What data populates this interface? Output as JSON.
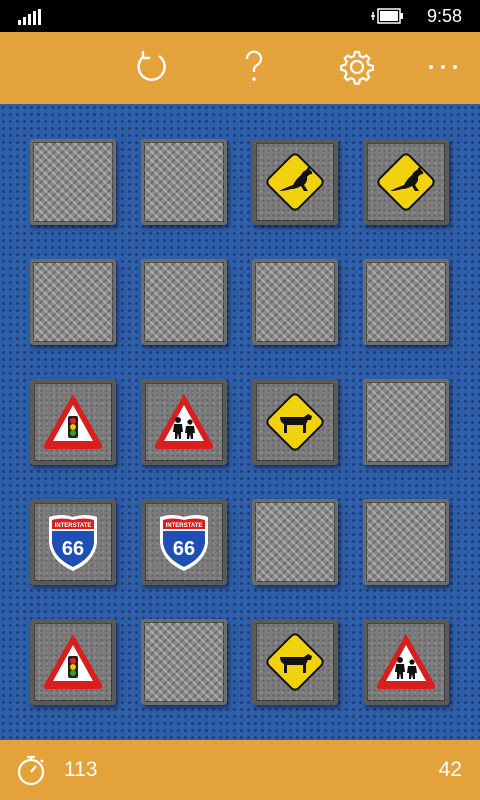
{
  "status": {
    "time": "9:58"
  },
  "toolbar": {
    "buttons": [
      {
        "name": "restart-button",
        "icon": "refresh-icon"
      },
      {
        "name": "help-button",
        "icon": "question-icon"
      },
      {
        "name": "settings-button",
        "icon": "gear-icon"
      },
      {
        "name": "more-button",
        "icon": "ellipsis-icon"
      }
    ]
  },
  "board": {
    "rows": 5,
    "cols": 4,
    "tiles": [
      "hidden",
      "hidden",
      "kangaroo-sign",
      "kangaroo-sign",
      "hidden",
      "hidden",
      "hidden",
      "hidden",
      "traffic-light-sign",
      "school-children-sign",
      "cattle-sign",
      "hidden",
      "route-66-sign",
      "route-66-sign",
      "hidden",
      "hidden",
      "traffic-light-sign",
      "hidden",
      "cattle-sign",
      "school-children-sign"
    ],
    "route_sign_top": "INTERSTATE",
    "route_sign_number": "66"
  },
  "footer": {
    "timer": "113",
    "score": "42",
    "timer_icon": "stopwatch-icon"
  },
  "colors": {
    "toolbar": "#e3a23a",
    "board": "#2f5ea8",
    "sign_red": "#d81e1e",
    "sign_yellow": "#f2d20f"
  }
}
